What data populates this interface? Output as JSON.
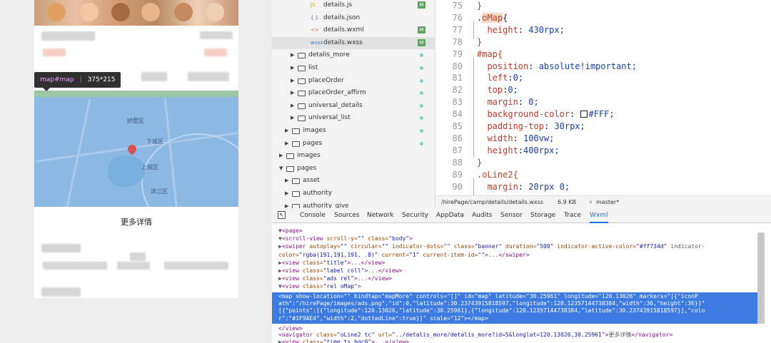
{
  "preview": {
    "tooltip_tag": "map#map",
    "tooltip_size": "375*215",
    "map_labels": [
      "拱墅区",
      "下城区",
      "上城区",
      "滨江区"
    ],
    "detail_label": "更多详情"
  },
  "file_tree": [
    {
      "name": "details.js",
      "type": "js",
      "badge": "M",
      "indent": 3
    },
    {
      "name": "details.json",
      "type": "json",
      "indent": 3
    },
    {
      "name": "details.wxml",
      "type": "wxml",
      "badge": "M",
      "indent": 3
    },
    {
      "name": "details.wxss",
      "type": "wxss",
      "badge": "M",
      "indent": 3,
      "selected": true
    },
    {
      "name": "detalis_more",
      "type": "folder",
      "dot": true,
      "indent": 2
    },
    {
      "name": "list",
      "type": "folder",
      "dot": true,
      "indent": 2
    },
    {
      "name": "placeOrder",
      "type": "folder",
      "dot": true,
      "indent": 2
    },
    {
      "name": "placeOrder_affirm",
      "type": "folder",
      "dot": true,
      "indent": 2
    },
    {
      "name": "universal_details",
      "type": "folder",
      "dot": true,
      "indent": 2
    },
    {
      "name": "universal_list",
      "type": "folder",
      "dot": true,
      "indent": 2
    },
    {
      "name": "images",
      "type": "folder",
      "dot": true,
      "indent": 1
    },
    {
      "name": "pages",
      "type": "folder",
      "dot": true,
      "indent": 1
    },
    {
      "name": "images",
      "type": "folder",
      "indent": 0
    },
    {
      "name": "pages",
      "type": "folder-open",
      "indent": 0
    },
    {
      "name": "asset",
      "type": "folder",
      "indent": 1
    },
    {
      "name": "authority",
      "type": "folder",
      "indent": 1
    },
    {
      "name": "authority_give",
      "type": "folder",
      "indent": 1
    }
  ],
  "code_lines": [
    {
      "n": "75",
      "text": "}"
    },
    {
      "n": "76",
      "text": ".oMap{"
    },
    {
      "n": "77",
      "text": "  height: 430rpx;"
    },
    {
      "n": "78",
      "text": "}"
    },
    {
      "n": "79",
      "text": "#map{"
    },
    {
      "n": "80",
      "text": "  position: absolute!important;"
    },
    {
      "n": "81",
      "text": "  left:0;"
    },
    {
      "n": "82",
      "text": "  top:0;"
    },
    {
      "n": "83",
      "text": "  margin: 0;"
    },
    {
      "n": "84",
      "text": "  background-color: #FFF;"
    },
    {
      "n": "85",
      "text": "  padding-top: 30rpx;"
    },
    {
      "n": "86",
      "text": "  width: 100vw;"
    },
    {
      "n": "87",
      "text": "  height:400rpx;"
    },
    {
      "n": "88",
      "text": "}"
    },
    {
      "n": "89",
      "text": ".oLine2{"
    },
    {
      "n": "90",
      "text": "  margin: 20rpx 0;"
    }
  ],
  "status_bar": {
    "path": "/hirePage/camp/details/details.wxss",
    "size": "6.9 KB",
    "branch": "master*"
  },
  "devtools_tabs": [
    "Console",
    "Sources",
    "Network",
    "Security",
    "AppData",
    "Audits",
    "Sensor",
    "Storage",
    "Trace",
    "Wxml"
  ],
  "active_tab": "Wxml",
  "dom_lines": [
    "▼<page>",
    "  ▼<scroll-view  scroll-y=\"\"  class=\"body\">",
    "    ▶<swiper  autoplay=\"\"  circular=\"\"  indicator-dots=\"\"  class=\"banner\"  duration=\"500\"  indicator-active-color=\"#ff734d\"  indicator-",
    "    color=\"rgba(191,191,191, .8)\"  current=\"1\"  current-item-id=\"\">...</swiper>",
    "    ▶<view  class=\"title\">...</view>",
    "    ▶<view  class=\"label coll\">...</view>",
    "    ▶<view  class=\"ads rel\">...</view>",
    "    ▼<view  class=\"rel oMap\">",
    "        <map  show-location=\"\"  bindtap=\"mapMore\"  controls=\"[]\"  id=\"map\"  latitude=\"30.25961\"  longitude=\"120.13026\"  markers=\"[{\"iconP",
    "        ath\":\"/hirePage/images/ads.png\",\"id\":0,\"latitude\":30.23743915818597,\"longitude\":120.12357144738384,\"width\":36,\"height\":36}]\"",
    "        [{\"points\":[{\"longitude\":120.13026,\"latitude\":30.25961},{\"longitude\":120.12357144738384,\"latitude\":30.23743915818597}],\"colo",
    "        r\":\"#1F9AE4\",\"width\":2,\"dottedLine\":true}]\"  scale=\"12\"></map>",
    "      </view>",
    "      <navigator  class=\"oLine2 tc\"  url=\"../detalis_more/detalis_more?id=5&longlat=120.13026,30.25961\">更多详情</navigator>",
    "    ▶<view  class=\"time ts bgc0\">...</view>"
  ]
}
